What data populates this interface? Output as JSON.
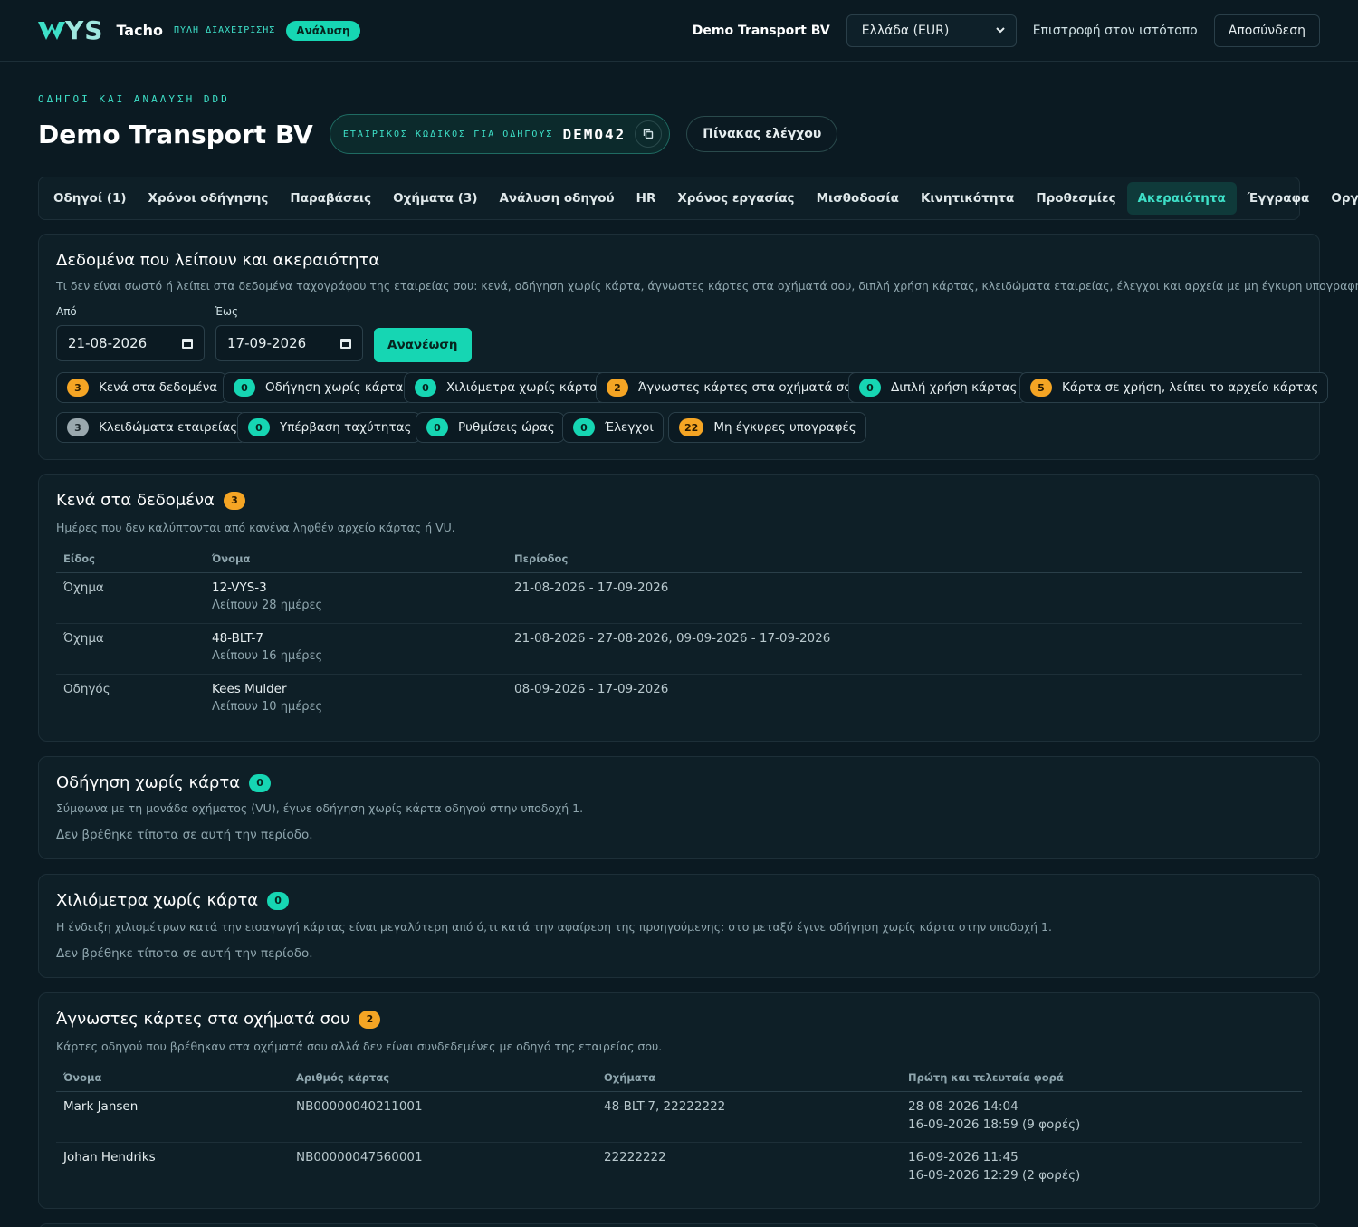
{
  "topbar": {
    "logo_ys": "YS",
    "logo_name": "Tacho",
    "logo_sub": "ΠΥΛΗ ΔΙΑΧΕΙΡΙΣΗΣ",
    "badge": "Ανάλυση",
    "company": "Demo Transport BV",
    "country_select": "Ελλάδα (EUR)",
    "back_link": "Επιστροφή στον ιστότοπο",
    "logout": "Αποσύνδεση"
  },
  "header": {
    "eyebrow": "ΟΔΗΓΟΙ ΚΑΙ ΑΝΑΛΥΣΗ DDD",
    "title": "Demo Transport BV",
    "code_label": "ΕΤΑΙΡΙΚΟΣ ΚΩΔΙΚΟΣ ΓΙΑ ΟΔΗΓΟΥΣ",
    "code_value": "DEMO42",
    "dashboard_button": "Πίνακας ελέγχου"
  },
  "tabs": [
    {
      "label": "Οδηγοί (1)"
    },
    {
      "label": "Χρόνοι οδήγησης"
    },
    {
      "label": "Παραβάσεις"
    },
    {
      "label": "Οχήματα (3)"
    },
    {
      "label": "Ανάλυση οδηγού"
    },
    {
      "label": "HR"
    },
    {
      "label": "Χρόνος εργασίας"
    },
    {
      "label": "Μισθοδοσία"
    },
    {
      "label": "Κινητικότητα"
    },
    {
      "label": "Προθεσμίες"
    },
    {
      "label": "Ακεραιότητα",
      "active": true
    },
    {
      "label": "Έγγραφα"
    },
    {
      "label": "Οργανισμός"
    }
  ],
  "integrity": {
    "title": "Δεδομένα που λείπουν και ακεραιότητα",
    "description": "Τι δεν είναι σωστό ή λείπει στα δεδομένα ταχογράφου της εταιρείας σου: κενά, οδήγηση χωρίς κάρτα, άγνωστες κάρτες στα οχήματά σου, διπλή χρήση κάρτας, κλειδώματα εταιρείας, έλεγχοι και αρχεία με μη έγκυρη υπογραφή.",
    "from_label": "Από",
    "from_value": "21-08-2026",
    "to_label": "Έως",
    "to_value": "17-09-2026",
    "refresh": "Ανανέωση",
    "chips": [
      {
        "count": "3",
        "label": "Κενά στα δεδομένα",
        "color": "orange"
      },
      {
        "count": "0",
        "label": "Οδήγηση χωρίς κάρτα",
        "color": "teal"
      },
      {
        "count": "0",
        "label": "Χιλιόμετρα χωρίς κάρτα",
        "color": "teal"
      },
      {
        "count": "2",
        "label": "Άγνωστες κάρτες στα οχήματά σου",
        "color": "orange"
      },
      {
        "count": "0",
        "label": "Διπλή χρήση κάρτας",
        "color": "teal"
      },
      {
        "count": "5",
        "label": "Κάρτα σε χρήση, λείπει το αρχείο κάρτας",
        "color": "orange"
      },
      {
        "count": "3",
        "label": "Κλειδώματα εταιρείας",
        "color": "grey"
      },
      {
        "count": "0",
        "label": "Υπέρβαση ταχύτητας",
        "color": "teal"
      },
      {
        "count": "0",
        "label": "Ρυθμίσεις ώρας",
        "color": "teal"
      },
      {
        "count": "0",
        "label": "Έλεγχοι",
        "color": "teal"
      },
      {
        "count": "22",
        "label": "Μη έγκυρες υπογραφές",
        "color": "orange"
      }
    ]
  },
  "gaps": {
    "title": "Κενά στα δεδομένα",
    "count": "3",
    "description": "Ημέρες που δεν καλύπτονται από κανένα ληφθέν αρχείο κάρτας ή VU.",
    "headers": [
      "Είδος",
      "Όνομα",
      "Περίοδος"
    ],
    "rows": [
      {
        "type": "Όχημα",
        "name": "12-VYS-3",
        "sub": "Λείπουν 28 ημέρες",
        "period": "21-08-2026 - 17-09-2026"
      },
      {
        "type": "Όχημα",
        "name": "48-BLT-7",
        "sub": "Λείπουν 16 ημέρες",
        "period": "21-08-2026 - 27-08-2026, 09-09-2026 - 17-09-2026"
      },
      {
        "type": "Οδηγός",
        "name": "Kees Mulder",
        "sub": "Λείπουν 10 ημέρες",
        "period": "08-09-2026 - 17-09-2026"
      }
    ]
  },
  "no_card": {
    "title": "Οδήγηση χωρίς κάρτα",
    "count": "0",
    "description": "Σύμφωνα με τη μονάδα οχήματος (VU), έγινε οδήγηση χωρίς κάρτα οδηγού στην υποδοχή 1.",
    "empty": "Δεν βρέθηκε τίποτα σε αυτή την περίοδο."
  },
  "km_no_card": {
    "title": "Χιλιόμετρα χωρίς κάρτα",
    "count": "0",
    "description": "Η ένδειξη χιλιομέτρων κατά την εισαγωγή κάρτας είναι μεγαλύτερη από ό,τι κατά την αφαίρεση της προηγούμενης: στο μεταξύ έγινε οδήγηση χωρίς κάρτα στην υποδοχή 1.",
    "empty": "Δεν βρέθηκε τίποτα σε αυτή την περίοδο."
  },
  "unknown_cards": {
    "title": "Άγνωστες κάρτες στα οχήματά σου",
    "count": "2",
    "description": "Κάρτες οδηγού που βρέθηκαν στα οχήματά σου αλλά δεν είναι συνδεδεμένες με οδηγό της εταιρείας σου.",
    "headers": [
      "Όνομα",
      "Αριθμός κάρτας",
      "Οχήματα",
      "Πρώτη και τελευταία φορά"
    ],
    "rows": [
      {
        "name": "Mark Jansen",
        "card": "NB00000040211001",
        "vehicles": "48-BLT-7, 22222222",
        "first": "28-08-2026 14:04",
        "last": "16-09-2026 18:59 (9 φορές)"
      },
      {
        "name": "Johan Hendriks",
        "card": "NB00000047560001",
        "vehicles": "22222222",
        "first": "16-09-2026 11:45",
        "last": "16-09-2026 12:29 (2 φορές)"
      }
    ]
  }
}
